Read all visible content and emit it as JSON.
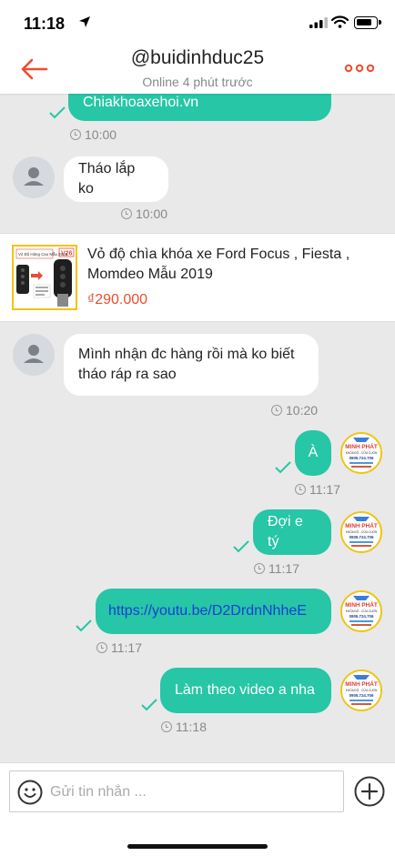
{
  "status_bar": {
    "time": "11:18"
  },
  "header": {
    "title": "@buidinhduc25",
    "subtitle": "Online 4 phút trước"
  },
  "messages": [
    {
      "text": "Chiakhoaxehoi.vn",
      "time": "10:00"
    },
    {
      "text": "Tháo lắp ko",
      "time": "10:00"
    },
    {
      "text": "Mình nhận đc hàng rồi mà ko biết tháo ráp ra sao",
      "time": "10:20"
    },
    {
      "text": "À",
      "time": "11:17"
    },
    {
      "text": "Đợi e tý",
      "time": "11:17"
    },
    {
      "text": "https://youtu.be/D2DrdnNhheE",
      "time": "11:17"
    },
    {
      "text": "Làm theo video a nha",
      "time": "11:18"
    }
  ],
  "product": {
    "title": "Vỏ độ chìa khóa xe Ford Focus , Fiesta , Momdeo Mẫu 2019",
    "price": "₫290.000",
    "image_badge": "V26",
    "image_caption": "Vỏ Độ Hàng Cao Mẫu 2019"
  },
  "shop_avatar": {
    "name": "MINH PHÁT",
    "line1": "KHÓA ĐỘ - CỬA CUỐN",
    "phone": "0905.724.706"
  },
  "input": {
    "placeholder": "Gửi tin nhắn ..."
  },
  "colors": {
    "accent": "#ee4d2d",
    "bubble_mine": "#26c6a6",
    "link": "#1a3fd6",
    "check": "#26c6a6"
  }
}
